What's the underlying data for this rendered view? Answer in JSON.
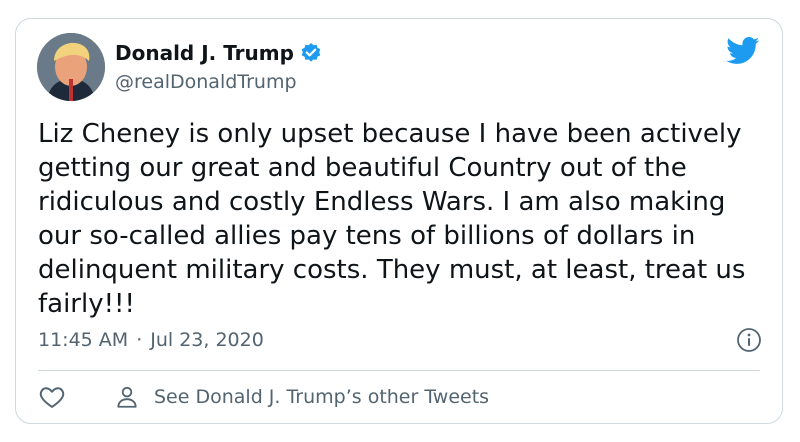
{
  "tweet": {
    "author_name": "Donald J. Trump",
    "handle": "@realDonaldTrump",
    "text_lines": [
      "Liz Cheney is only upset because I have been actively",
      "getting our great and beautiful Country out of the",
      "ridiculous and costly Endless Wars. I am also making",
      "our so-called allies pay tens of billions of dollars in",
      "delinquent military costs. They must, at least, treat us",
      "fairly!!!"
    ],
    "time": "11:45 AM",
    "separator": "·",
    "date": "Jul 23, 2020"
  },
  "actions": {
    "other_tweets_label": "See Donald J. Trump’s other Tweets"
  },
  "icons": {
    "verified": "verified-badge-icon",
    "brand": "twitter-bird-icon",
    "info": "info-icon",
    "like": "heart-icon",
    "profile": "person-icon"
  },
  "colors": {
    "brand_blue": "#1d9bf0",
    "text": "#0f1419",
    "secondary_text": "#536471",
    "border": "#cfd9de"
  }
}
